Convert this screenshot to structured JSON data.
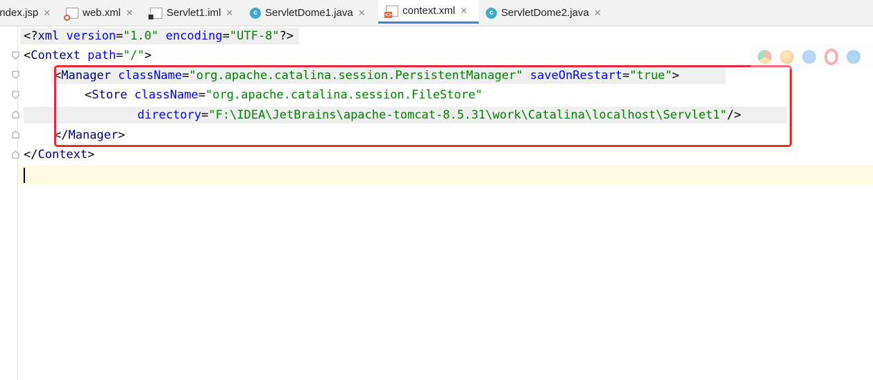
{
  "tabs": [
    {
      "label": "index.jsp",
      "icon": "jsp-file-icon",
      "active": false
    },
    {
      "label": "web.xml",
      "icon": "web-xml-icon",
      "active": false
    },
    {
      "label": "Servlet1.iml",
      "icon": "iml-file-icon",
      "active": false
    },
    {
      "label": "ServletDome1.java",
      "icon": "java-class-icon",
      "active": false
    },
    {
      "label": "context.xml",
      "icon": "xml-file-icon",
      "active": true
    },
    {
      "label": "ServletDome2.java",
      "icon": "java-class-icon",
      "active": false
    }
  ],
  "code": {
    "l1": {
      "open": "<?",
      "tag": "xml",
      "a1": " version",
      "eq1": "=",
      "s1": "\"1.0\"",
      "a2": " encoding",
      "eq2": "=",
      "s2": "\"UTF-8\"",
      "close": "?>"
    },
    "l2": {
      "open": "<",
      "tag": "Context",
      "a1": " path",
      "eq1": "=",
      "s1": "\"/\"",
      "close": ">"
    },
    "l3": {
      "open": "<",
      "tag": "Manager",
      "a1": " className",
      "eq1": "=",
      "s1": "\"org.apache.catalina.session.PersistentManager\"",
      "a2": " saveOnRestart",
      "eq2": "=",
      "s2": "\"true\"",
      "close": ">"
    },
    "l4": {
      "open": "<",
      "tag": "Store",
      "a1": " className",
      "eq1": "=",
      "s1": "\"org.apache.catalina.session.FileStore\""
    },
    "l5": {
      "a1": "directory",
      "eq1": "=",
      "s1": "\"F:\\IDEA\\JetBrains\\apache-tomcat-8.5.31\\work\\Catalina\\localhost\\Servlet1\"",
      "close": "/>"
    },
    "l6": {
      "open": "</",
      "tag": "Manager",
      "close": ">"
    },
    "l7": {
      "open": "</",
      "tag": "Context",
      "close": ">"
    }
  },
  "colors": {
    "tag": "#000080",
    "attribute": "#0000ff",
    "string": "#008000",
    "highlight_box": "#e8292f",
    "active_tab_underline": "#4083c9",
    "caret_line": "#fffae3"
  },
  "browser_icons": [
    "chrome-icon",
    "firefox-icon",
    "safari-icon",
    "opera-icon",
    "ie-icon"
  ]
}
